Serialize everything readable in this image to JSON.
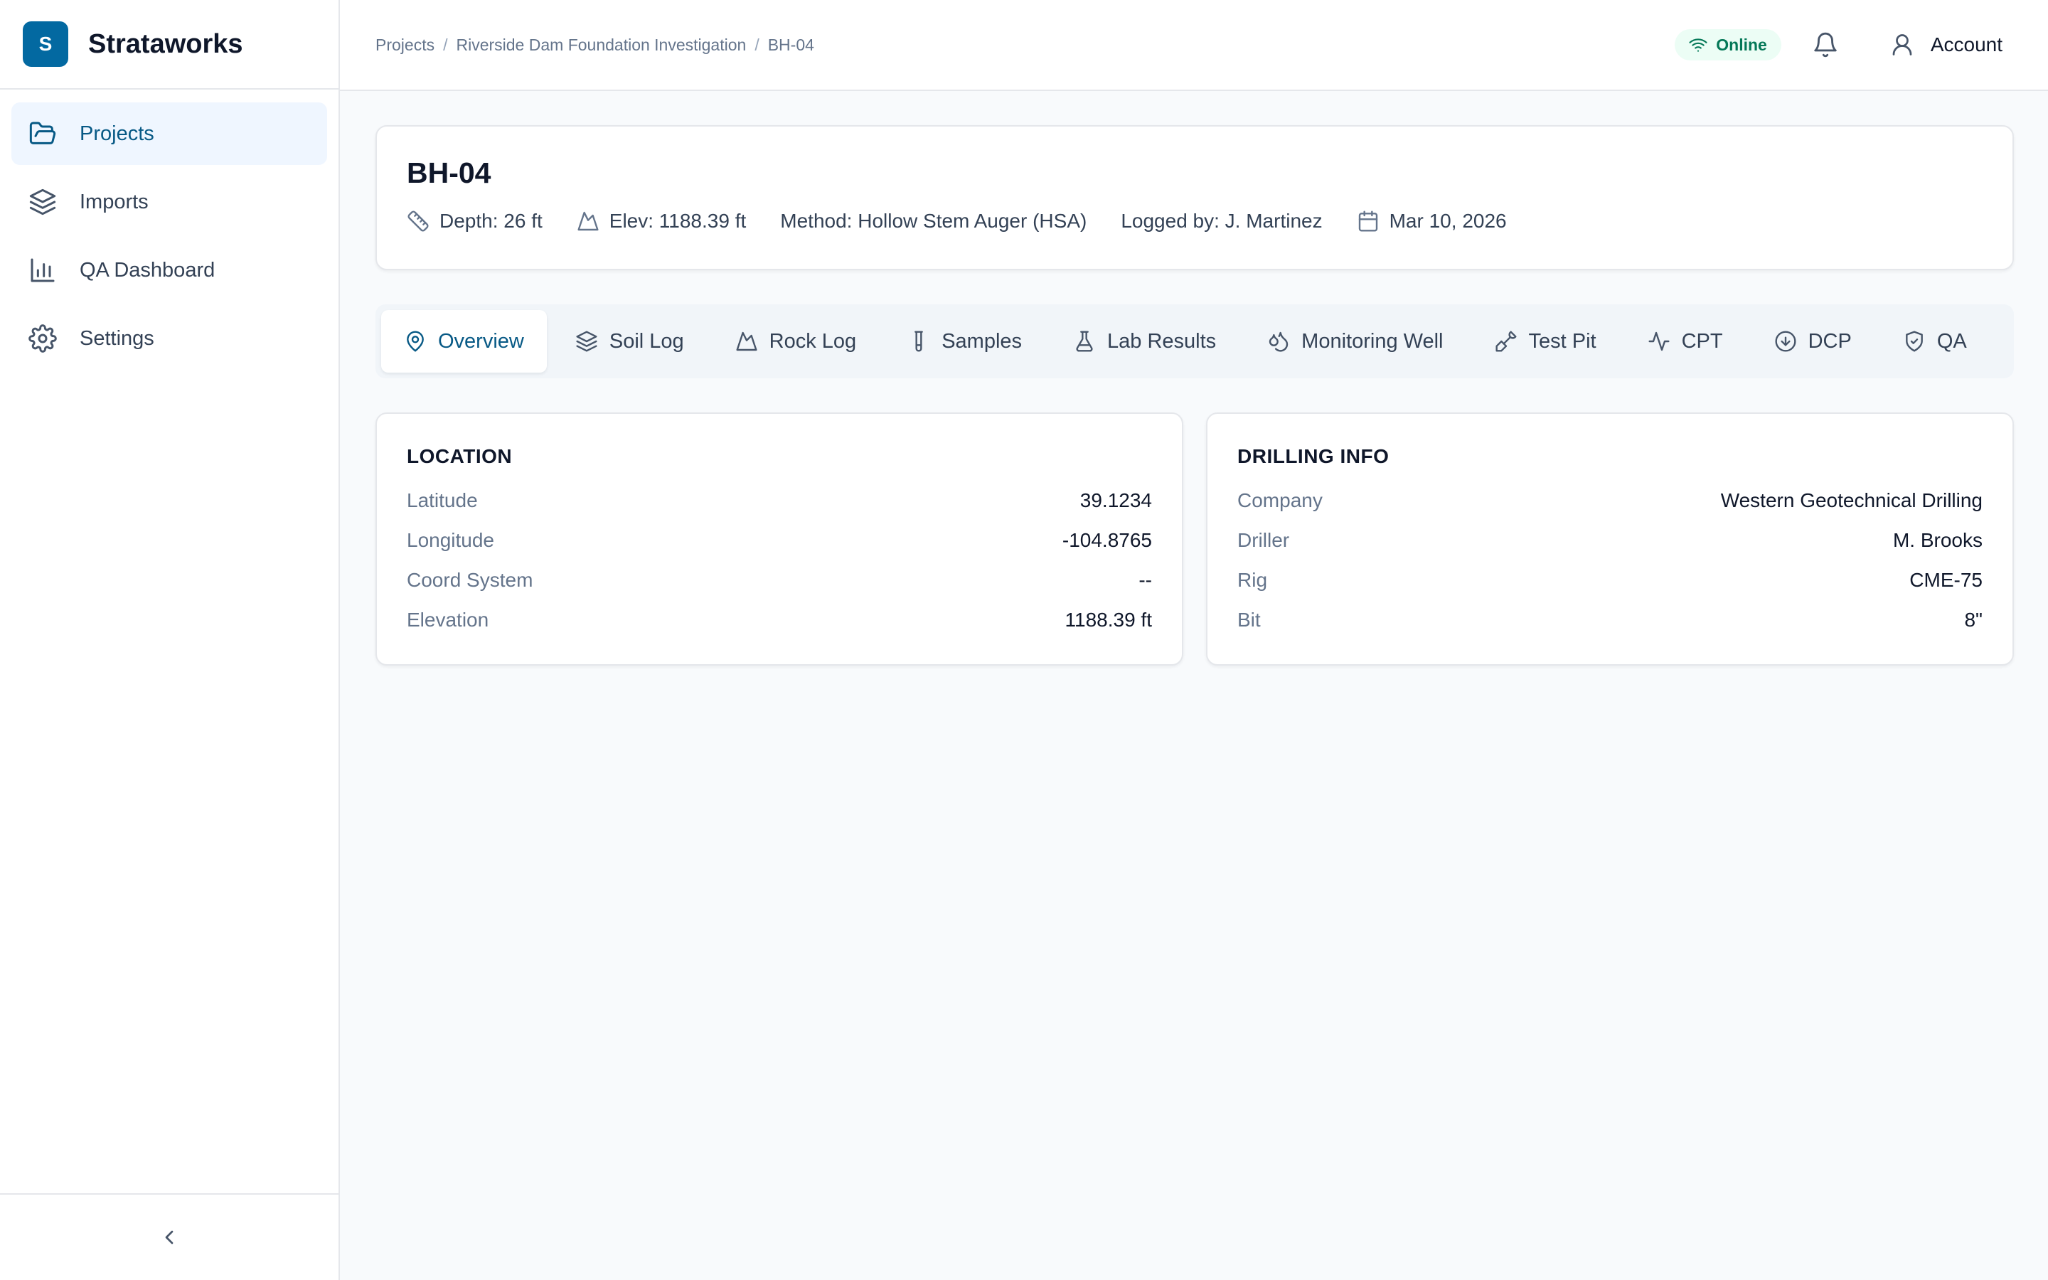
{
  "app": {
    "name": "Strataworks",
    "logo_letter": "S"
  },
  "sidebar": {
    "items": [
      {
        "label": "Projects",
        "icon": "folder-open-icon",
        "active": true
      },
      {
        "label": "Imports",
        "icon": "layers-icon"
      },
      {
        "label": "QA Dashboard",
        "icon": "bar-chart-icon"
      },
      {
        "label": "Settings",
        "icon": "gear-icon"
      }
    ],
    "collapse_icon": "chevron-left-icon"
  },
  "header": {
    "breadcrumb": [
      "Projects",
      "Riverside Dam Foundation Investigation",
      "BH-04"
    ],
    "breadcrumb_separator": "/",
    "status": "Online",
    "account_label": "Account"
  },
  "borehole": {
    "title": "BH-04",
    "depth": "Depth: 26 ft",
    "elevation": "Elev: 1188.39 ft",
    "method": "Method: Hollow Stem Auger (HSA)",
    "logged_by": "Logged by: J. Martinez",
    "date": "Mar 10, 2026"
  },
  "tabs": [
    {
      "label": "Overview",
      "icon": "map-pin-icon",
      "active": true
    },
    {
      "label": "Soil Log",
      "icon": "layers-icon"
    },
    {
      "label": "Rock Log",
      "icon": "mountain-icon"
    },
    {
      "label": "Samples",
      "icon": "test-tube-icon"
    },
    {
      "label": "Lab Results",
      "icon": "flask-icon"
    },
    {
      "label": "Monitoring Well",
      "icon": "droplets-icon"
    },
    {
      "label": "Test Pit",
      "icon": "shovel-icon"
    },
    {
      "label": "CPT",
      "icon": "activity-icon"
    },
    {
      "label": "DCP",
      "icon": "arrow-down-circle-icon"
    },
    {
      "label": "QA",
      "icon": "shield-check-icon"
    }
  ],
  "location": {
    "title": "LOCATION",
    "rows": [
      {
        "key": "Latitude",
        "value": "39.1234"
      },
      {
        "key": "Longitude",
        "value": "-104.8765"
      },
      {
        "key": "Coord System",
        "value": "--"
      },
      {
        "key": "Elevation",
        "value": "1188.39 ft"
      }
    ]
  },
  "drilling": {
    "title": "DRILLING INFO",
    "rows": [
      {
        "key": "Company",
        "value": "Western Geotechnical Drilling"
      },
      {
        "key": "Driller",
        "value": "M. Brooks"
      },
      {
        "key": "Rig",
        "value": "CME-75"
      },
      {
        "key": "Bit",
        "value": "8\""
      }
    ]
  },
  "colors": {
    "brand": "#0369a1",
    "active_text": "#075985",
    "active_bg": "#eff6ff",
    "online_bg": "#ecfdf5",
    "online_text": "#047857",
    "page_bg": "#f8fafc"
  }
}
